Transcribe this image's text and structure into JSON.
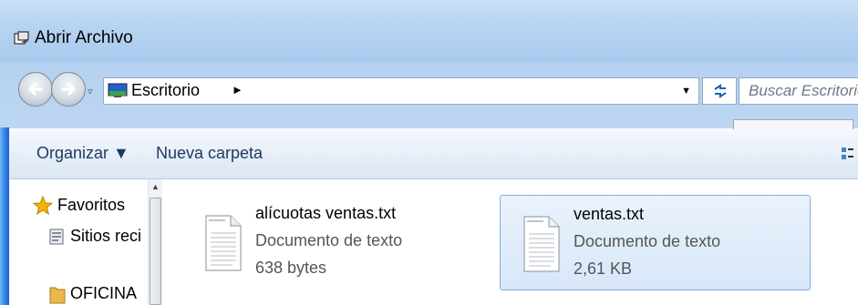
{
  "window": {
    "title": "Abrir Archivo",
    "title_icon": "open-file-dialog-icon"
  },
  "address_bar": {
    "back_icon": "back-arrow-icon",
    "forward_icon": "forward-arrow-icon",
    "history_dropdown": "▿",
    "location_icon": "desktop-icon",
    "location": "Escritorio",
    "breadcrumb_arrow": "►",
    "dropdown": "▼",
    "refresh_icon": "refresh-icon",
    "search_placeholder": "Buscar Escritorio"
  },
  "toolbar": {
    "organize": "Organizar ▼",
    "new_folder": "Nueva carpeta",
    "view_icon": "change-view-icon"
  },
  "nav_pane": {
    "items": [
      {
        "label": "Favoritos",
        "icon": "star-icon"
      },
      {
        "label": "Sitios reci",
        "icon": "recent-places-icon"
      },
      {
        "label": "OFICINA",
        "icon": "folder-icon"
      }
    ]
  },
  "files": [
    {
      "name": "alícuotas ventas.txt",
      "type": "Documento de texto",
      "size": "638 bytes",
      "icon": "text-document-icon",
      "selected": false
    },
    {
      "name": "ventas.txt",
      "type": "Documento de texto",
      "size": "2,61 KB",
      "icon": "text-document-icon",
      "selected": true
    }
  ],
  "colors": {
    "selection": "#d8e7f9",
    "window_frame": "#2a66c9",
    "toolbar_text": "#1e395b"
  }
}
